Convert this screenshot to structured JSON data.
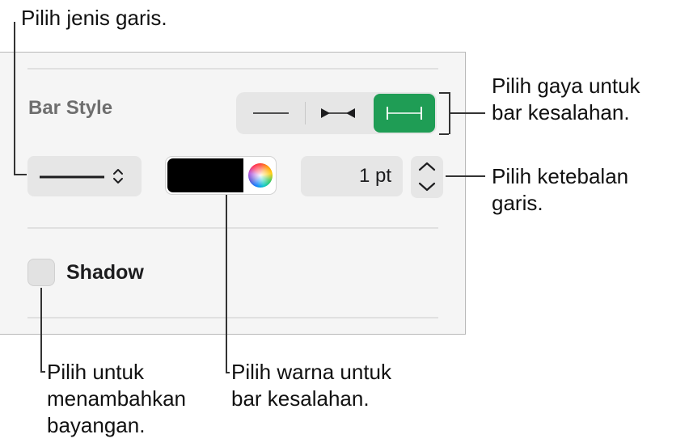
{
  "callouts": {
    "line_type": "Pilih jenis garis.",
    "bar_style_1": "Pilih gaya untuk",
    "bar_style_2": "bar kesalahan.",
    "thickness_1": "Pilih ketebalan",
    "thickness_2": "garis.",
    "shadow_1": "Pilih untuk",
    "shadow_2": "menambahkan",
    "shadow_3": "bayangan.",
    "color_1": "Pilih warna untuk",
    "color_2": "bar kesalahan."
  },
  "panel": {
    "bar_style_label": "Bar Style",
    "bar_style_options": [
      "none-icon",
      "arrow-caps-icon",
      "bar-caps-icon"
    ],
    "bar_style_selected": 2,
    "line_style_value": "solid-line",
    "color": "#000000",
    "thickness": "1 pt",
    "shadow_label": "Shadow",
    "shadow_checked": false
  },
  "colors": {
    "accent_green": "#1f9d55"
  }
}
